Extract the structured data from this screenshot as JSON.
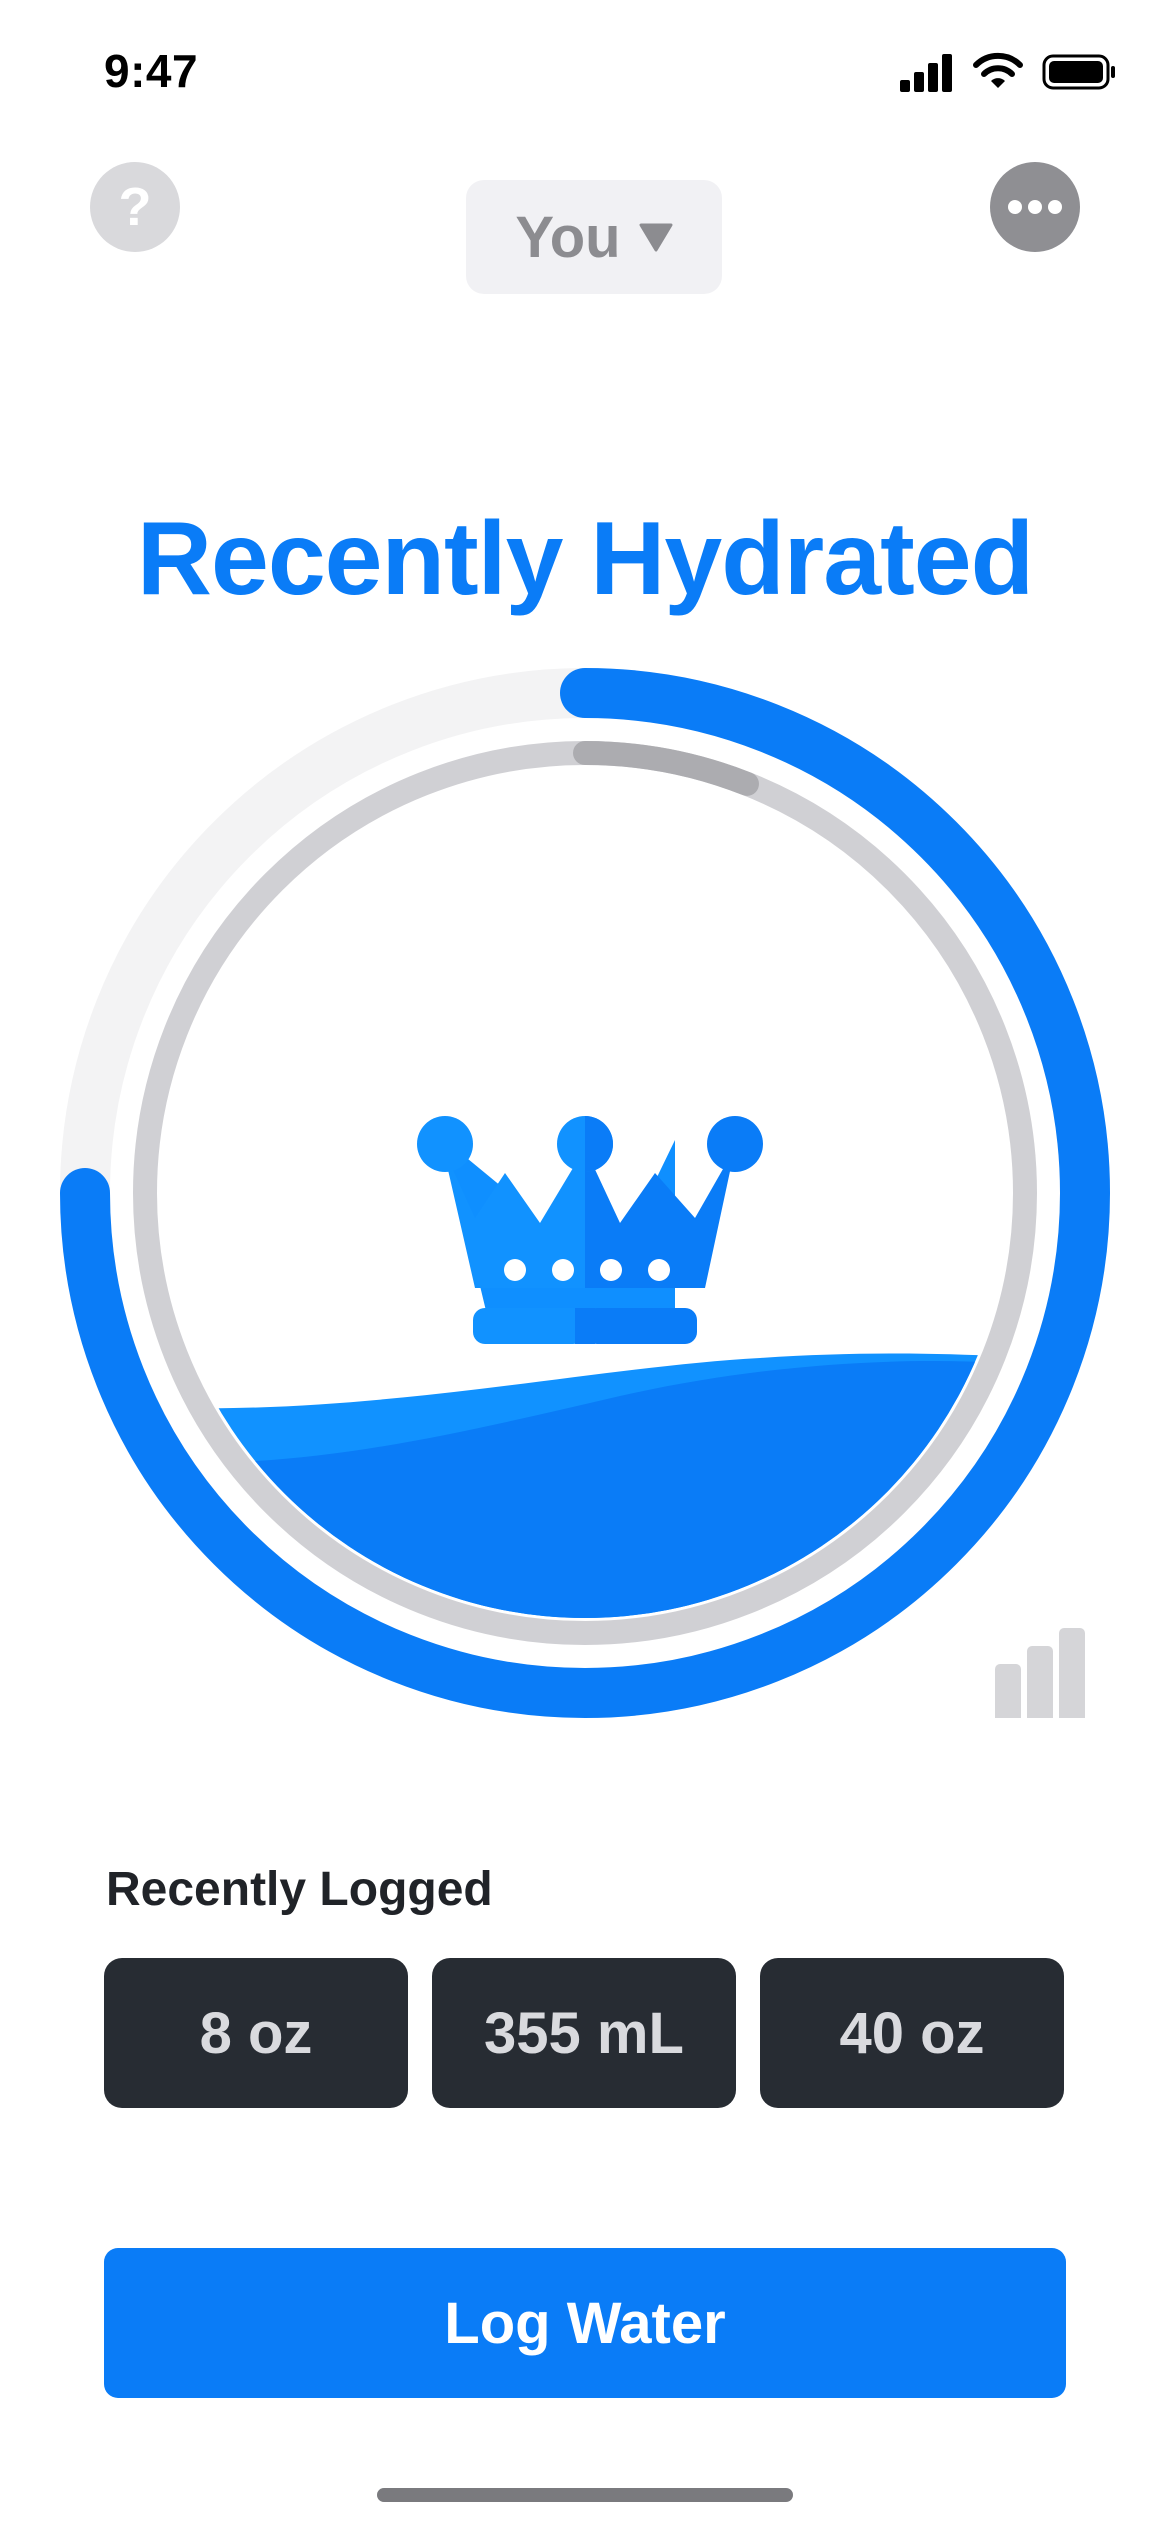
{
  "status_bar": {
    "time": "9:47"
  },
  "header": {
    "help_icon_glyph": "?",
    "user_selector_label": "You",
    "more_icon": "ellipsis-icon"
  },
  "headline": "Recently Hydrated",
  "progress": {
    "outer_ring_fraction": 0.75,
    "inner_ring_fraction": 0.06,
    "water_level_fraction": 0.3,
    "accent_color": "#0a7cf7",
    "icon": "crown-icon",
    "stats_icon": "bar-chart-icon"
  },
  "recently_logged": {
    "label": "Recently Logged",
    "items": [
      "8 oz",
      "355 mL",
      "40 oz"
    ]
  },
  "primary_action": {
    "label": "Log Water"
  }
}
